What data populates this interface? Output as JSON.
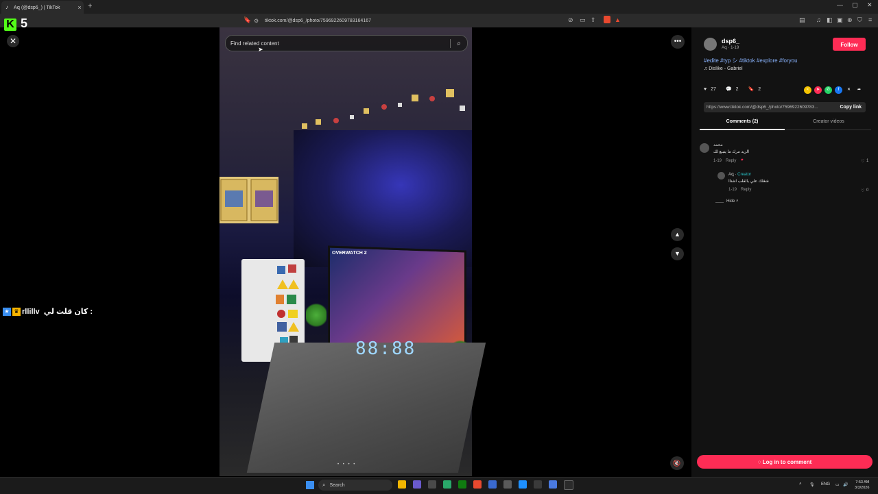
{
  "browser": {
    "tab_title": "Aꝗ (@dsp6_) | TikTok",
    "tab_close": "×",
    "new_tab": "+",
    "url": "tiktok.com/@dsp6_/photo/7596922609783164167"
  },
  "overlay": {
    "kick_logo": "K",
    "kick_count": "5",
    "chat_user": "rllillv",
    "chat_message": "كان قلت لي :"
  },
  "viewer": {
    "close": "✕",
    "search_placeholder": "Find related content",
    "more": "•••",
    "nav_up": "▲",
    "nav_down": "▼",
    "mute": "🔇",
    "monitor_title": "OVERWATCH 2",
    "clock_display": "88:88",
    "carousel_dots": "• • • •"
  },
  "post": {
    "username": "dsp6_",
    "subline": "Aꝗ · 1-19",
    "follow_label": "Follow",
    "hashtags": "#edite #typ シ #tiktok #explore #foryou",
    "music": "♫  Dislike - Gabriel",
    "likes": "27",
    "comments": "2",
    "saves": "2",
    "link": "https://www.tiktok.com/@dsp6_/photo/7596922609783...",
    "copy_label": "Copy link"
  },
  "tabs": {
    "comments": "Comments (2)",
    "creator_videos": "Creator videos"
  },
  "comments": [
    {
      "name": "محمد",
      "text": "الزيد مرك ما يتبنع لك",
      "date": "1-19",
      "reply": "Reply",
      "likes": "1"
    }
  ],
  "reply": {
    "name": "Aꝗ",
    "tag": "Creator",
    "text": "شغلك علي بالقلب اشتاا",
    "date": "1-19",
    "reply": "Reply",
    "likes": "0"
  },
  "hide_label": "Hide ˄",
  "login_label": "Log in to comment",
  "taskbar": {
    "search": "Search",
    "lang": "ENG",
    "time": "7:53 AM",
    "date": "3/3/2026"
  },
  "colors": {
    "accent": "#fe2c55",
    "creator": "#28c4c9",
    "kick": "#53fc18"
  }
}
